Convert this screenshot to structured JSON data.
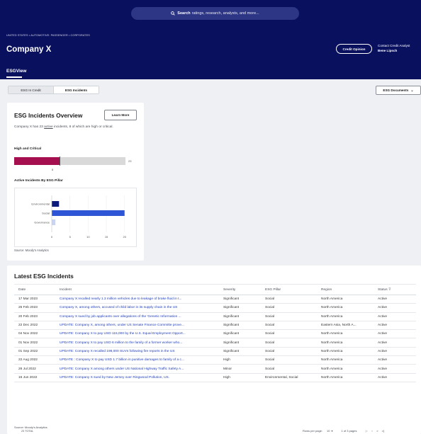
{
  "search": {
    "bold": "Search",
    "rest": "ratings, research, analysts, and more..."
  },
  "breadcrumb": "UNITED STATES • AUTOMOTIVE: PASSENGER • CORPORATES",
  "company_title": "Company X",
  "credit_opinion_label": "Credit Opinion",
  "contact": {
    "label": "Contact Credit Analyst",
    "name": "Bene Lipsch"
  },
  "esgview_label": "ESGView",
  "tabs": [
    "ESG In Credit",
    "ESG Incidents"
  ],
  "esg_documents_label": "ESG Documents",
  "overview": {
    "title": "ESG Incidents Overview",
    "learn_more": "Learn More",
    "desc_pre": "Company X has 23 ",
    "desc_active": "active",
    "desc_post": " incidents, 8 of which are high or critical.",
    "high_critical_label": "High and Critical",
    "high_critical_count": "8",
    "high_critical_total": "23",
    "pillar_title": "Active Incidents By ESG Pillar",
    "source": "Source: Moody's Analytics"
  },
  "chart_data": {
    "type": "bar",
    "orientation": "horizontal",
    "categories": [
      "Environmental",
      "Social",
      "Governance"
    ],
    "values": [
      2,
      20,
      1
    ],
    "xticks": [
      "0",
      "5",
      "10",
      "15",
      "20"
    ],
    "xlim": [
      0,
      22
    ],
    "colors": [
      "#0a1a7a",
      "#2e55d6",
      "#c9d3f3"
    ],
    "grid": true
  },
  "incidents": {
    "title": "Latest ESG Incidents",
    "columns": [
      "Date",
      "Incident",
      "Severity",
      "ESG Pillar",
      "Region",
      "Status"
    ],
    "rows": [
      [
        "17 Mar 2023",
        "Company X recalled nearly 1.3 million vehicles due to leakage of brake fluid in t...",
        "Significant",
        "Social",
        "North America",
        "Active"
      ],
      [
        "25 Feb 2023",
        "Company X, among others, accused of child labor in its supply chain in the US",
        "Significant",
        "Social",
        "North America",
        "Active"
      ],
      [
        "20 Feb 2023",
        "Company X sued by job applicants over allegations of the 'Genetic Information ...",
        "Significant",
        "Social",
        "North America",
        "Active"
      ],
      [
        "22 Dec 2022",
        "UPDATE: Company X, among others, under US Senate Finance Committe prove...",
        "Significant",
        "Social",
        "Eastern Asia, North A...",
        "Active"
      ],
      [
        "04 Nov 2022",
        "UPDATE: Company X to pay USD 115,000 by the U.S. Equal Employment Opport...",
        "Significant",
        "Social",
        "North America",
        "Active"
      ],
      [
        "01 Nov 2022",
        "UPDATE: Company X to pay USD 6 million to the family of a former worker who...",
        "Significant",
        "Social",
        "North America",
        "Active"
      ],
      [
        "01 Sep 2022",
        "UPDATE: Company X recalled 198,000 SUVs following fire reports in the US",
        "Significant",
        "Social",
        "North America",
        "Active"
      ],
      [
        "22 Aug 2022",
        "UPDATE : Company X to pay USD 1.7 billion in punitive damages to family of a c...",
        "High",
        "Social",
        "North America",
        "Active"
      ],
      [
        "26 Jul 2022",
        "UPDATE: Company X among others under US National Highway Traffic Safety A...",
        "Minor",
        "Social",
        "North America",
        "Active"
      ],
      [
        "16 Jun 2022",
        "UPDATE: Company X sued by New Jersey over Ringwood Pollution, US.",
        "High",
        "Environmental, Social",
        "North America",
        "Active"
      ]
    ],
    "total": "23 TOTAL",
    "rows_per_page_label": "Rows per page:",
    "rows_per_page": "10",
    "page_info": "1 of 3 pages",
    "source": "Source: Moody's Analytics"
  }
}
